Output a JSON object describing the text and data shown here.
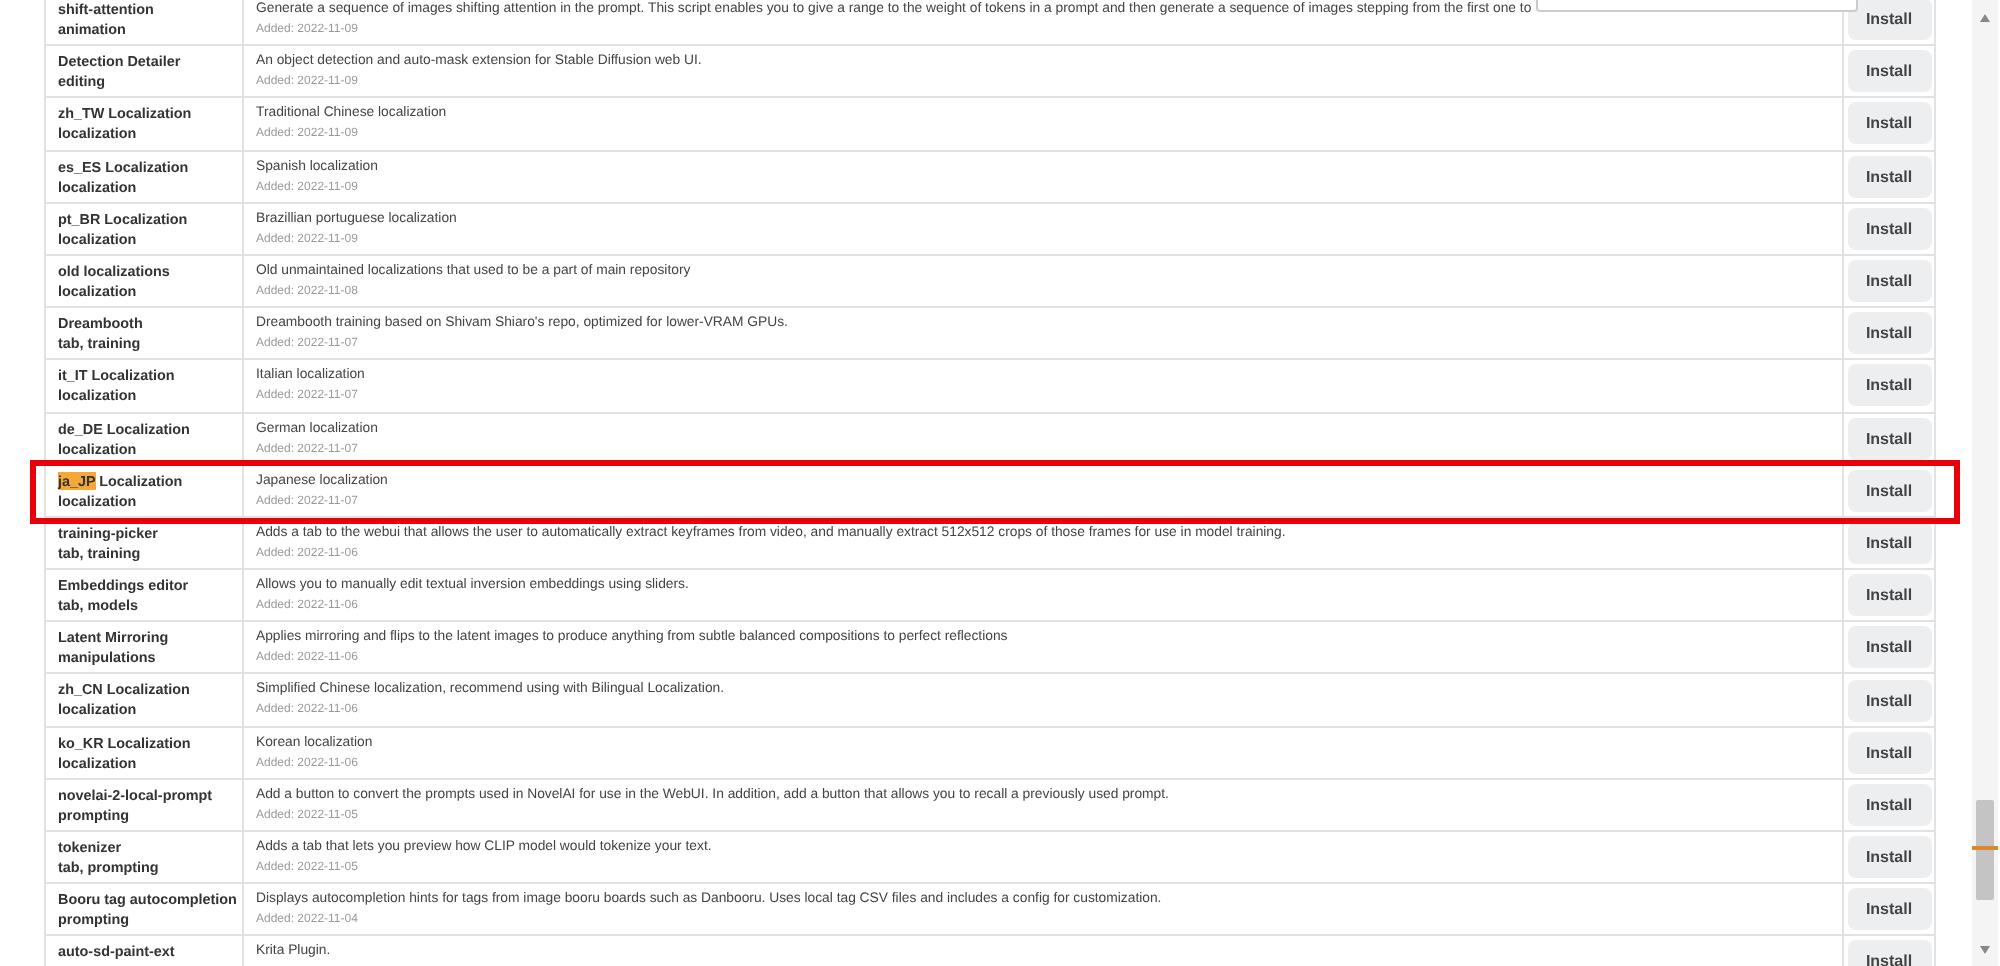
{
  "extensions": [
    {
      "name_parts": [
        {
          "text": "shift-attention",
          "highlighted": false
        }
      ],
      "tags": "animation",
      "description": "Generate a sequence of images shifting attention in the prompt. This script enables you to give a range to the weight of tokens in a prompt and then generate a sequence of images stepping from the first one to",
      "added": "Added: 2022-11-09",
      "button": "Install",
      "outlined": false
    },
    {
      "name_parts": [
        {
          "text": "Detection Detailer",
          "highlighted": false
        }
      ],
      "tags": "editing",
      "description": "An object detection and auto-mask extension for Stable Diffusion web UI.",
      "added": "Added: 2022-11-09",
      "button": "Install",
      "outlined": false
    },
    {
      "name_parts": [
        {
          "text": "zh_TW Localization",
          "highlighted": false
        }
      ],
      "tags": "localization",
      "description": "Traditional Chinese localization",
      "added": "Added: 2022-11-09",
      "button": "Install",
      "outlined": false
    },
    {
      "name_parts": [
        {
          "text": "es_ES Localization",
          "highlighted": false
        }
      ],
      "tags": "localization",
      "description": "Spanish localization",
      "added": "Added: 2022-11-09",
      "button": "Install",
      "outlined": false
    },
    {
      "name_parts": [
        {
          "text": "pt_BR Localization",
          "highlighted": false
        }
      ],
      "tags": "localization",
      "description": "Brazillian portuguese localization",
      "added": "Added: 2022-11-09",
      "button": "Install",
      "outlined": false
    },
    {
      "name_parts": [
        {
          "text": "old localizations",
          "highlighted": false
        }
      ],
      "tags": "localization",
      "description": "Old unmaintained localizations that used to be a part of main repository",
      "added": "Added: 2022-11-08",
      "button": "Install",
      "outlined": false
    },
    {
      "name_parts": [
        {
          "text": "Dreambooth",
          "highlighted": false
        }
      ],
      "tags": "tab, training",
      "description": "Dreambooth training based on Shivam Shiaro's repo, optimized for lower-VRAM GPUs.",
      "added": "Added: 2022-11-07",
      "button": "Install",
      "outlined": false
    },
    {
      "name_parts": [
        {
          "text": "it_IT Localization",
          "highlighted": false
        }
      ],
      "tags": "localization",
      "description": "Italian localization",
      "added": "Added: 2022-11-07",
      "button": "Install",
      "outlined": false
    },
    {
      "name_parts": [
        {
          "text": "de_DE Localization",
          "highlighted": false
        }
      ],
      "tags": "localization",
      "description": "German localization",
      "added": "Added: 2022-11-07",
      "button": "Install",
      "outlined": false
    },
    {
      "name_parts": [
        {
          "text": "ja_JP",
          "highlighted": true
        },
        {
          "text": " Localization",
          "highlighted": false
        }
      ],
      "tags": "localization",
      "description": "Japanese localization",
      "added": "Added: 2022-11-07",
      "button": "Install",
      "outlined": true
    },
    {
      "name_parts": [
        {
          "text": "training-picker",
          "highlighted": false
        }
      ],
      "tags": "tab, training",
      "description": "Adds a tab to the webui that allows the user to automatically extract keyframes from video, and manually extract 512x512 crops of those frames for use in model training.",
      "added": "Added: 2022-11-06",
      "button": "Install",
      "outlined": false
    },
    {
      "name_parts": [
        {
          "text": "Embeddings editor",
          "highlighted": false
        }
      ],
      "tags": "tab, models",
      "description": "Allows you to manually edit textual inversion embeddings using sliders.",
      "added": "Added: 2022-11-06",
      "button": "Install",
      "outlined": false
    },
    {
      "name_parts": [
        {
          "text": "Latent Mirroring",
          "highlighted": false
        }
      ],
      "tags": "manipulations",
      "description": "Applies mirroring and flips to the latent images to produce anything from subtle balanced compositions to perfect reflections",
      "added": "Added: 2022-11-06",
      "button": "Install",
      "outlined": false
    },
    {
      "name_parts": [
        {
          "text": "zh_CN Localization",
          "highlighted": false
        }
      ],
      "tags": "localization",
      "description": "Simplified Chinese localization, recommend using with Bilingual Localization.",
      "added": "Added: 2022-11-06",
      "button": "Install",
      "outlined": false
    },
    {
      "name_parts": [
        {
          "text": "ko_KR Localization",
          "highlighted": false
        }
      ],
      "tags": "localization",
      "description": "Korean localization",
      "added": "Added: 2022-11-06",
      "button": "Install",
      "outlined": false
    },
    {
      "name_parts": [
        {
          "text": "novelai-2-local-prompt",
          "highlighted": false
        }
      ],
      "tags": "prompting",
      "description": "Add a button to convert the prompts used in NovelAI for use in the WebUI. In addition, add a button that allows you to recall a previously used prompt.",
      "added": "Added: 2022-11-05",
      "button": "Install",
      "outlined": false
    },
    {
      "name_parts": [
        {
          "text": "tokenizer",
          "highlighted": false
        }
      ],
      "tags": "tab, prompting",
      "description": "Adds a tab that lets you preview how CLIP model would tokenize your text.",
      "added": "Added: 2022-11-05",
      "button": "Install",
      "outlined": false
    },
    {
      "name_parts": [
        {
          "text": "Booru tag autocompletion",
          "highlighted": false
        }
      ],
      "tags": "prompting",
      "description": "Displays autocompletion hints for tags from image booru boards such as Danbooru. Uses local tag CSV files and includes a config for customization.",
      "added": "Added: 2022-11-04",
      "button": "Install",
      "outlined": false
    },
    {
      "name_parts": [
        {
          "text": "auto-sd-paint-ext",
          "highlighted": false
        }
      ],
      "description": "Krita Plugin.",
      "button": "Install",
      "outlined": false
    }
  ]
}
